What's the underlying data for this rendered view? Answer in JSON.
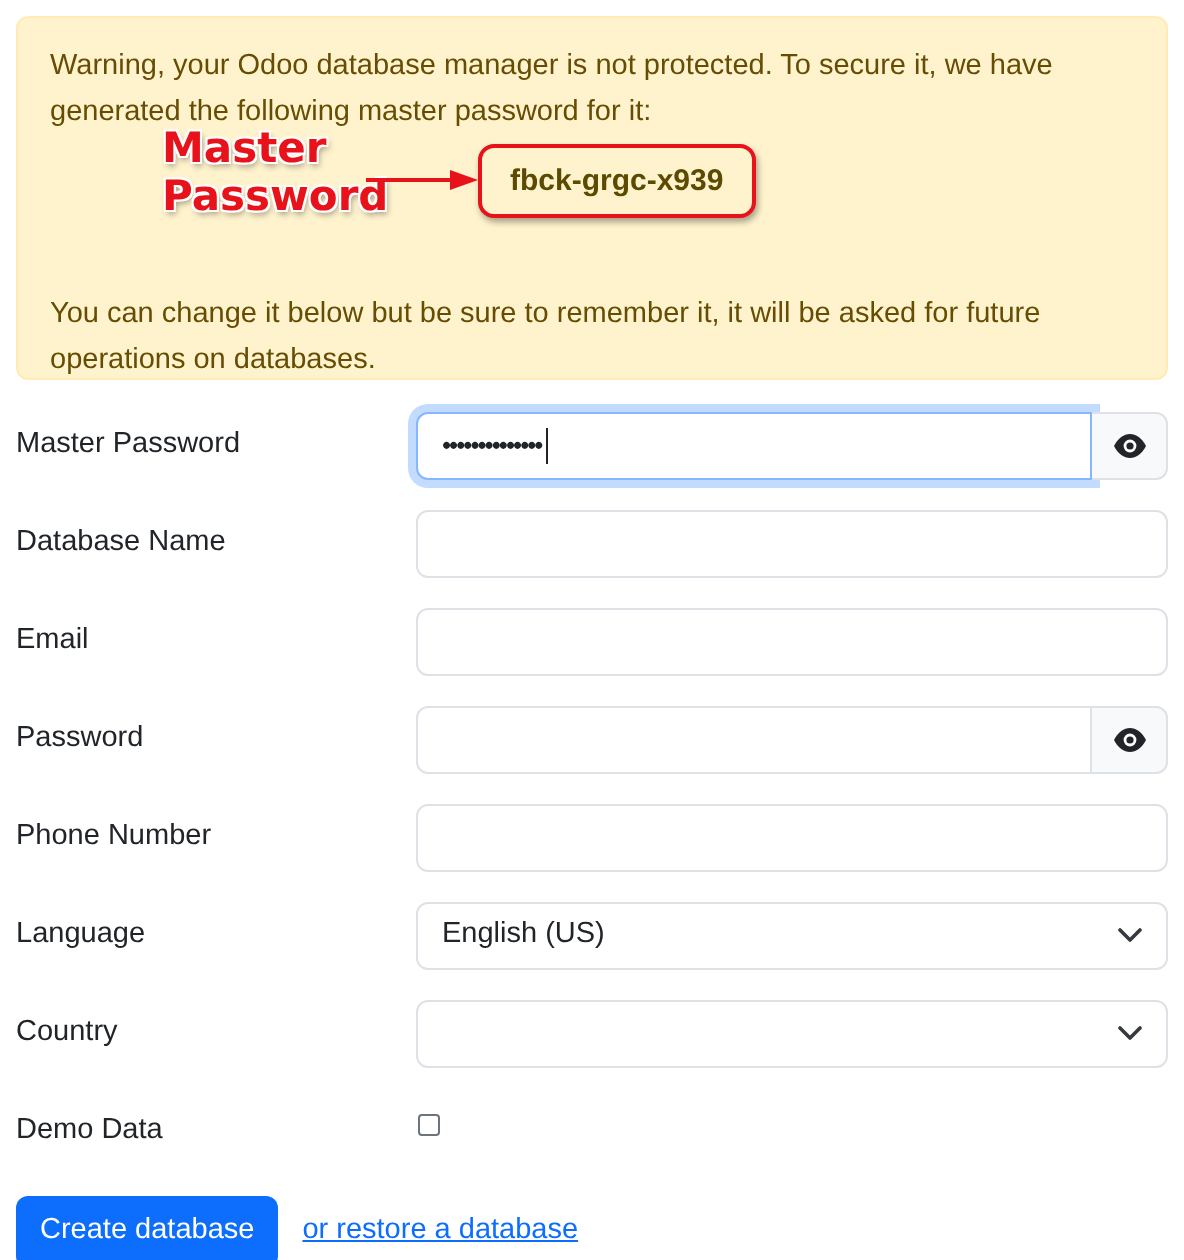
{
  "alert": {
    "message": "Warning, your Odoo database manager is not protected. To secure it, we have generated the following master password for it:",
    "generated_password": "fbck-grgc-x939",
    "annotation": "Master Password",
    "note": "You can change it below but be sure to remember it, it will be asked for future operations on databases."
  },
  "fields": [
    {
      "kind": "password",
      "label": "Master Password",
      "value": "••••••••••••••",
      "focused": true
    },
    {
      "kind": "text",
      "label": "Database Name",
      "focused": false
    },
    {
      "kind": "text",
      "label": "Email",
      "focused": false
    },
    {
      "kind": "password",
      "label": "Password",
      "focused": false
    },
    {
      "kind": "text",
      "label": "Phone Number",
      "focused": false
    },
    {
      "kind": "select",
      "label": "Language",
      "value": "English (US)",
      "focused": false
    },
    {
      "kind": "select",
      "label": "Country",
      "focused": false
    },
    {
      "kind": "checkbox",
      "label": "Demo Data",
      "checked": false
    }
  ],
  "actions": [
    {
      "kind": "button",
      "label": "Create database"
    },
    {
      "kind": "link",
      "label": "or restore a database"
    }
  ]
}
